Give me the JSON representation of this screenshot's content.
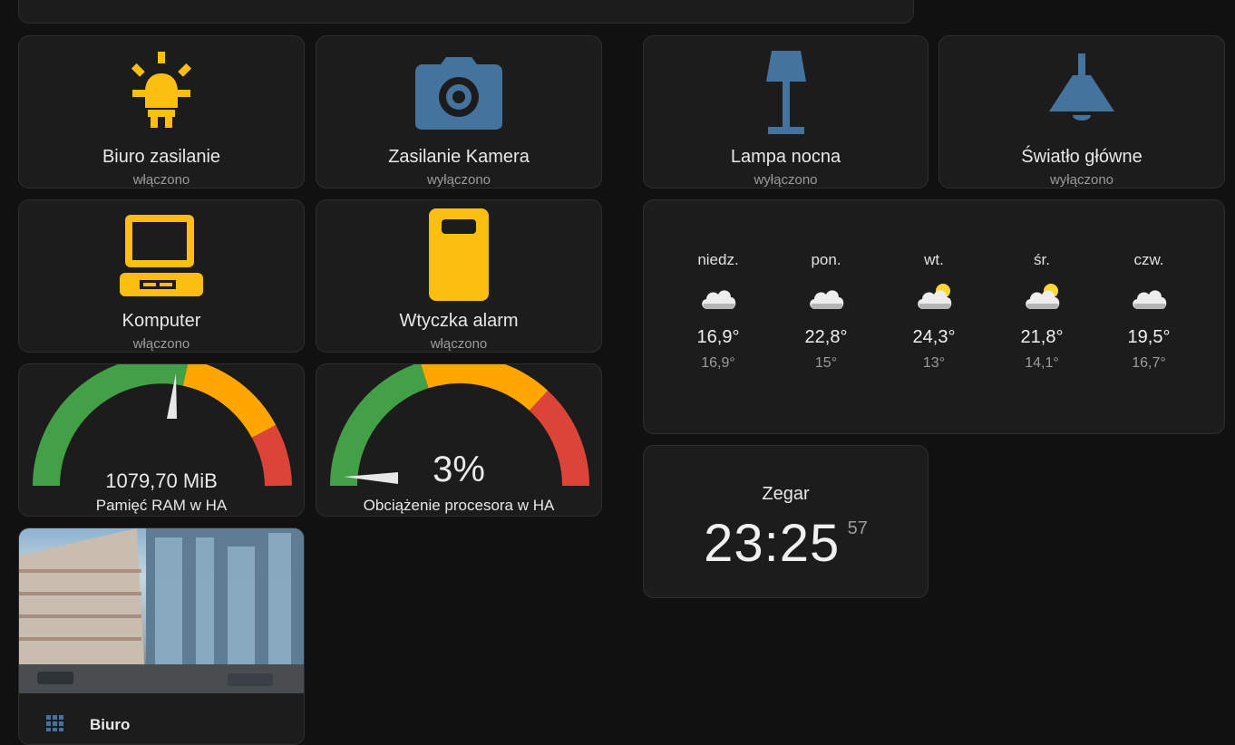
{
  "colors": {
    "on": "#fcbf0f",
    "off": "#44739e",
    "green": "#43a047",
    "orange": "#ffa600",
    "red": "#db4437"
  },
  "tiles": [
    {
      "name": "Biuro zasilanie",
      "state": "włączono",
      "icon": "lightbulb-on-icon"
    },
    {
      "name": "Zasilanie Kamera",
      "state": "wyłączono",
      "icon": "camera-icon"
    },
    {
      "name": "Lampa nocna",
      "state": "wyłączono",
      "icon": "floor-lamp-icon"
    },
    {
      "name": "Światło główne",
      "state": "wyłączono",
      "icon": "ceiling-light-icon"
    },
    {
      "name": "Komputer",
      "state": "włączono",
      "icon": "desktop-computer-icon"
    },
    {
      "name": "Wtyczka alarm",
      "state": "włączono",
      "icon": "power-socket-icon"
    }
  ],
  "gauges": {
    "ram": {
      "value": "1079,70 MiB",
      "name": "Pamięć RAM w HA",
      "fraction": 0.53
    },
    "cpu": {
      "value": "3%",
      "name": "Obciążenie procesora w HA",
      "fraction": 0.03
    }
  },
  "weather": [
    {
      "day": "niedz.",
      "high": "16,9°",
      "low": "16,9°",
      "icon": "cloudy-icon"
    },
    {
      "day": "pon.",
      "high": "22,8°",
      "low": "15°",
      "icon": "cloudy-icon"
    },
    {
      "day": "wt.",
      "high": "24,3°",
      "low": "13°",
      "icon": "partly-cloudy-icon"
    },
    {
      "day": "śr.",
      "high": "21,8°",
      "low": "14,1°",
      "icon": "partly-cloudy-icon"
    },
    {
      "day": "czw.",
      "high": "19,5°",
      "low": "16,7°",
      "icon": "cloudy-icon"
    }
  ],
  "clock": {
    "title": "Zegar",
    "time": "23:25",
    "seconds": "57"
  },
  "area": {
    "name": "Biuro",
    "icon": "office-building-icon"
  }
}
